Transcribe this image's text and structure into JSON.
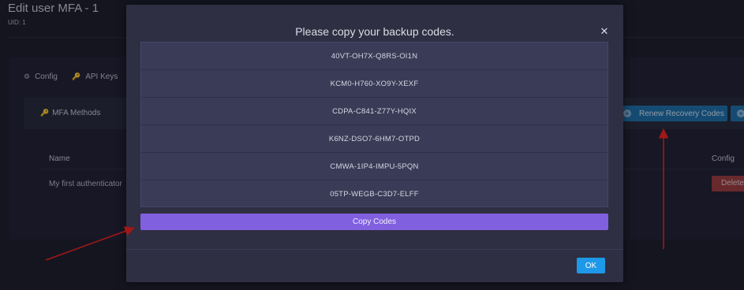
{
  "page": {
    "title": "Edit user MFA - 1",
    "subtitle": "UID: 1"
  },
  "tabs": [
    {
      "label": "Config",
      "icon": "cogs-icon"
    },
    {
      "label": "API Keys",
      "icon": "key-icon"
    }
  ],
  "mfa": {
    "title": "MFA Methods",
    "icon": "key-icon",
    "renew_label": "Renew Recovery Codes",
    "table": {
      "headers": [
        "Name",
        "Config"
      ],
      "rows": [
        {
          "name": "My first authenticator",
          "action": "Delete"
        }
      ]
    }
  },
  "modal": {
    "title": "Please copy your backup codes.",
    "close_icon": "close-icon",
    "codes": [
      "40VT-OH7X-Q8RS-OI1N",
      "KCM0-H760-XO9Y-XEXF",
      "CDPA-C841-Z77Y-HQIX",
      "K6NZ-DSO7-6HM7-OTPD",
      "CMWA-1IP4-IMPU-5PQN",
      "05TP-WEGB-C3D7-ELFF"
    ],
    "copy_label": "Copy Codes",
    "ok_label": "OK"
  },
  "colors": {
    "accent_purple": "#8160e0",
    "ok_blue": "#1e98e8",
    "renew_blue": "#1c6fa8",
    "danger_red": "#9a3b3b",
    "arrow_red": "#a01818"
  }
}
